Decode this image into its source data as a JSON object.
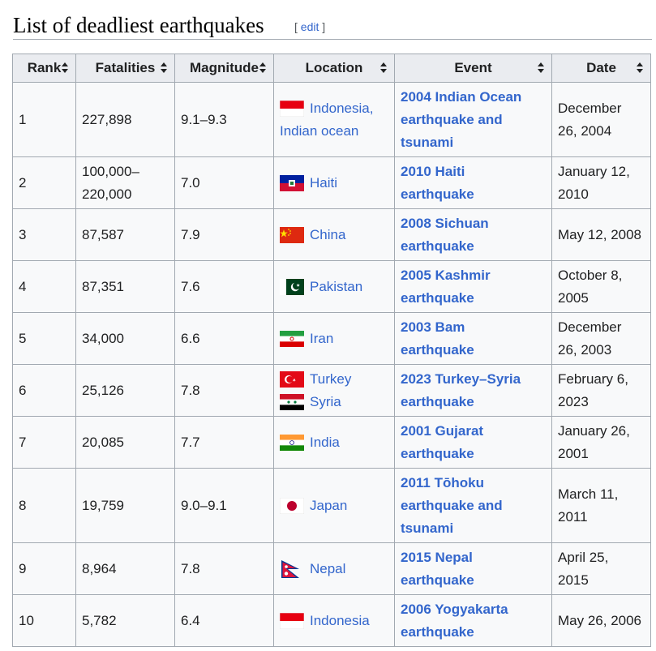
{
  "page": {
    "heading": "List of deadliest earthquakes",
    "edit_open": "[",
    "edit_label": "edit",
    "edit_close": "]"
  },
  "table": {
    "columns": [
      {
        "label": "Rank"
      },
      {
        "label": "Fatalities"
      },
      {
        "label": "Magnitude"
      },
      {
        "label": "Location"
      },
      {
        "label": "Event"
      },
      {
        "label": "Date"
      }
    ],
    "rows": [
      {
        "rank": "1",
        "fatalities": "227,898",
        "magnitude": "9.1–9.3",
        "locations": [
          {
            "flag": "indonesia-flag",
            "name": "Indonesia,"
          }
        ],
        "extra": "Indian ocean",
        "event": [
          "2004 Indian Ocean",
          "earthquake and",
          "tsunami"
        ],
        "date": [
          "December",
          "26, 2004"
        ]
      },
      {
        "rank": "2",
        "fatalities": "100,000–",
        "fatalities2": "220,000",
        "magnitude": "7.0",
        "locations": [
          {
            "flag": "haiti-flag",
            "name": "Haiti"
          }
        ],
        "event": [
          "2010 Haiti",
          "earthquake"
        ],
        "date": [
          "January 12,",
          "2010"
        ]
      },
      {
        "rank": "3",
        "fatalities": "87,587",
        "magnitude": "7.9",
        "locations": [
          {
            "flag": "china-flag",
            "name": "China"
          }
        ],
        "event": [
          "2008 Sichuan",
          "earthquake"
        ],
        "date": [
          "May 12, 2008"
        ]
      },
      {
        "rank": "4",
        "fatalities": "87,351",
        "magnitude": "7.6",
        "locations": [
          {
            "flag": "pakistan-flag",
            "name": "Pakistan"
          }
        ],
        "event": [
          "2005 Kashmir",
          "earthquake"
        ],
        "date": [
          "October 8,",
          "2005"
        ]
      },
      {
        "rank": "5",
        "fatalities": "34,000",
        "magnitude": "6.6",
        "locations": [
          {
            "flag": "iran-flag",
            "name": "Iran"
          }
        ],
        "event": [
          "2003 Bam",
          "earthquake"
        ],
        "date": [
          "December",
          "26, 2003"
        ]
      },
      {
        "rank": "6",
        "fatalities": "25,126",
        "magnitude": "7.8",
        "locations": [
          {
            "flag": "turkey-flag",
            "name": "Turkey"
          },
          {
            "flag": "syria-flag",
            "name": "Syria"
          }
        ],
        "event": [
          "2023 Turkey–Syria",
          "earthquake"
        ],
        "date": [
          "February 6,",
          "2023"
        ]
      },
      {
        "rank": "7",
        "fatalities": "20,085",
        "magnitude": "7.7",
        "locations": [
          {
            "flag": "india-flag",
            "name": "India"
          }
        ],
        "event": [
          "2001 Gujarat",
          "earthquake"
        ],
        "date": [
          "January 26,",
          "2001"
        ]
      },
      {
        "rank": "8",
        "fatalities": "19,759",
        "magnitude": "9.0–9.1",
        "locations": [
          {
            "flag": "japan-flag",
            "name": "Japan"
          }
        ],
        "event": [
          "2011 Tōhoku",
          "earthquake and",
          "tsunami"
        ],
        "date": [
          "March 11,",
          "2011"
        ]
      },
      {
        "rank": "9",
        "fatalities": "8,964",
        "magnitude": "7.8",
        "locations": [
          {
            "flag": "nepal-flag",
            "name": "Nepal"
          }
        ],
        "event": [
          "2015 Nepal",
          "earthquake"
        ],
        "date": [
          "April 25,",
          "2015"
        ]
      },
      {
        "rank": "10",
        "fatalities": "5,782",
        "magnitude": "6.4",
        "locations": [
          {
            "flag": "indonesia-flag",
            "name": "Indonesia"
          }
        ],
        "event": [
          "2006 Yogyakarta",
          "earthquake"
        ],
        "date": [
          "May 26, 2006"
        ]
      }
    ]
  },
  "colors": {
    "link": "#3366cc",
    "header_bg": "#eaecf0",
    "cell_bg": "#f8f9fa",
    "border": "#a2a9b1"
  }
}
